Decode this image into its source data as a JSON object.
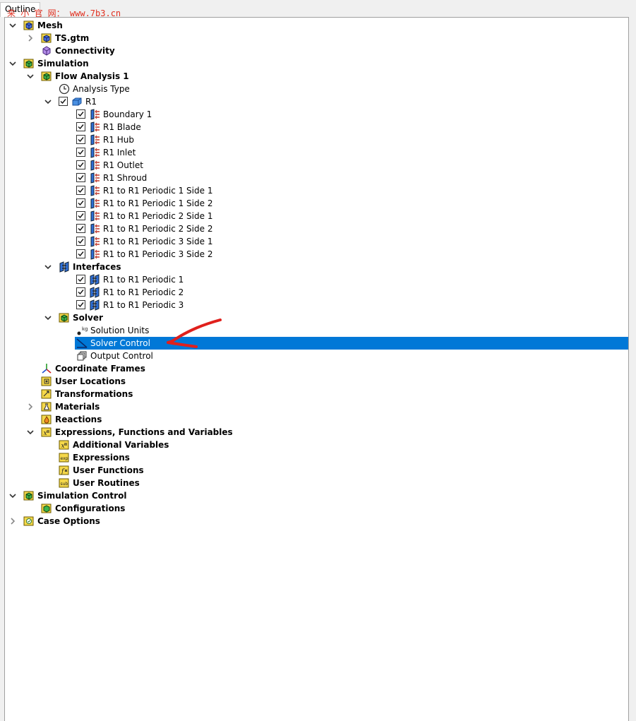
{
  "tab": {
    "label": "Outline"
  },
  "watermark": {
    "text": "来 小 官 网： www.7b3.cn"
  },
  "tree": [
    {
      "label": "Mesh",
      "level": 0,
      "twisty": "expanded",
      "bold": true,
      "icon": "mesh-folder-icon"
    },
    {
      "label": "TS.gtm",
      "level": 1,
      "twisty": "collapsed",
      "bold": true,
      "icon": "mesh-file-icon"
    },
    {
      "label": "Connectivity",
      "level": 1,
      "twisty": "none",
      "bold": true,
      "icon": "connectivity-icon"
    },
    {
      "label": "Simulation",
      "level": 0,
      "twisty": "expanded",
      "bold": true,
      "icon": "simulation-icon"
    },
    {
      "label": "Flow Analysis 1",
      "level": 1,
      "twisty": "expanded",
      "bold": true,
      "icon": "flow-analysis-icon"
    },
    {
      "label": "Analysis Type",
      "level": 2,
      "twisty": "none",
      "bold": false,
      "icon": "clock-icon"
    },
    {
      "label": "R1",
      "level": 2,
      "twisty": "expanded",
      "bold": false,
      "icon": "domain-icon",
      "checked": true
    },
    {
      "label": "Boundary 1",
      "level": 3,
      "twisty": "none",
      "bold": false,
      "icon": "boundary-icon",
      "checked": true
    },
    {
      "label": "R1 Blade",
      "level": 3,
      "twisty": "none",
      "bold": false,
      "icon": "boundary-icon",
      "checked": true
    },
    {
      "label": "R1 Hub",
      "level": 3,
      "twisty": "none",
      "bold": false,
      "icon": "boundary-icon",
      "checked": true
    },
    {
      "label": "R1 Inlet",
      "level": 3,
      "twisty": "none",
      "bold": false,
      "icon": "boundary-icon",
      "checked": true
    },
    {
      "label": "R1 Outlet",
      "level": 3,
      "twisty": "none",
      "bold": false,
      "icon": "boundary-icon",
      "checked": true
    },
    {
      "label": "R1 Shroud",
      "level": 3,
      "twisty": "none",
      "bold": false,
      "icon": "boundary-icon",
      "checked": true
    },
    {
      "label": "R1 to R1 Periodic 1 Side 1",
      "level": 3,
      "twisty": "none",
      "bold": false,
      "icon": "boundary-icon",
      "checked": true
    },
    {
      "label": "R1 to R1 Periodic 1 Side 2",
      "level": 3,
      "twisty": "none",
      "bold": false,
      "icon": "boundary-icon",
      "checked": true
    },
    {
      "label": "R1 to R1 Periodic 2 Side 1",
      "level": 3,
      "twisty": "none",
      "bold": false,
      "icon": "boundary-icon",
      "checked": true
    },
    {
      "label": "R1 to R1 Periodic 2 Side 2",
      "level": 3,
      "twisty": "none",
      "bold": false,
      "icon": "boundary-icon",
      "checked": true
    },
    {
      "label": "R1 to R1 Periodic 3 Side 1",
      "level": 3,
      "twisty": "none",
      "bold": false,
      "icon": "boundary-icon",
      "checked": true
    },
    {
      "label": "R1 to R1 Periodic 3 Side 2",
      "level": 3,
      "twisty": "none",
      "bold": false,
      "icon": "boundary-icon",
      "checked": true
    },
    {
      "label": "Interfaces",
      "level": 2,
      "twisty": "expanded",
      "bold": true,
      "icon": "interfaces-icon"
    },
    {
      "label": "R1 to R1 Periodic 1",
      "level": 3,
      "twisty": "none",
      "bold": false,
      "icon": "interface-icon",
      "checked": true
    },
    {
      "label": "R1 to R1 Periodic 2",
      "level": 3,
      "twisty": "none",
      "bold": false,
      "icon": "interface-icon",
      "checked": true
    },
    {
      "label": "R1 to R1 Periodic 3",
      "level": 3,
      "twisty": "none",
      "bold": false,
      "icon": "interface-icon",
      "checked": true
    },
    {
      "label": "Solver",
      "level": 2,
      "twisty": "expanded",
      "bold": true,
      "icon": "solver-icon"
    },
    {
      "label": "Solution Units",
      "level": 3,
      "twisty": "none",
      "bold": false,
      "icon": "units-icon"
    },
    {
      "label": "Solver Control",
      "level": 3,
      "twisty": "none",
      "bold": false,
      "icon": "solver-control-icon",
      "selected": true
    },
    {
      "label": "Output Control",
      "level": 3,
      "twisty": "none",
      "bold": false,
      "icon": "output-control-icon"
    },
    {
      "label": "Coordinate Frames",
      "level": 1,
      "twisty": "none",
      "bold": true,
      "icon": "coordinate-axes-icon"
    },
    {
      "label": "User Locations",
      "level": 1,
      "twisty": "none",
      "bold": true,
      "icon": "user-locations-icon"
    },
    {
      "label": "Transformations",
      "level": 1,
      "twisty": "none",
      "bold": true,
      "icon": "transformations-icon"
    },
    {
      "label": "Materials",
      "level": 1,
      "twisty": "collapsed",
      "bold": true,
      "icon": "materials-flask-icon"
    },
    {
      "label": "Reactions",
      "level": 1,
      "twisty": "none",
      "bold": true,
      "icon": "reactions-flame-icon"
    },
    {
      "label": "Expressions, Functions and Variables",
      "level": 1,
      "twisty": "expanded",
      "bold": true,
      "icon": "expressions-icon"
    },
    {
      "label": "Additional Variables",
      "level": 2,
      "twisty": "none",
      "bold": true,
      "icon": "additional-variables-icon"
    },
    {
      "label": "Expressions",
      "level": 2,
      "twisty": "none",
      "bold": true,
      "icon": "expressions-exp-icon"
    },
    {
      "label": "User Functions",
      "level": 2,
      "twisty": "none",
      "bold": true,
      "icon": "user-functions-icon"
    },
    {
      "label": "User Routines",
      "level": 2,
      "twisty": "none",
      "bold": true,
      "icon": "user-routines-sub-icon"
    },
    {
      "label": "Simulation Control",
      "level": 0,
      "twisty": "expanded",
      "bold": true,
      "icon": "simulation-control-icon"
    },
    {
      "label": "Configurations",
      "level": 1,
      "twisty": "none",
      "bold": true,
      "icon": "configurations-icon"
    },
    {
      "label": "Case Options",
      "level": 0,
      "twisty": "collapsed",
      "bold": true,
      "icon": "case-options-icon"
    }
  ],
  "colors": {
    "selection": "#0078d7",
    "folder_yellow": "#f5d84a",
    "boundary_blue": "#2f6fd6",
    "boundary_red": "#c0392b",
    "annotation_red": "#e0201c"
  }
}
